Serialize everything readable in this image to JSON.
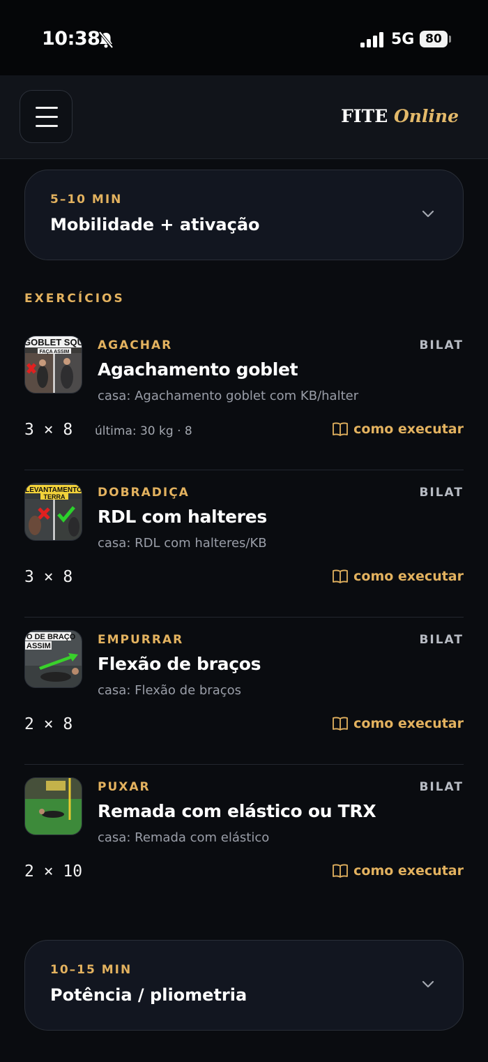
{
  "status": {
    "time": "10:38",
    "network": "5G",
    "battery": "80"
  },
  "header": {
    "brand_main": "FITE",
    "brand_accent": "Online",
    "menu_icon": "hamburger-menu-icon"
  },
  "phases": [
    {
      "time": "5–10 MIN",
      "title": "Mobilidade + ativação"
    },
    {
      "time": "10–15 MIN",
      "title": "Potência / pliometria"
    }
  ],
  "section_label": "EXERCÍCIOS",
  "exercises": [
    {
      "category": "AGACHAR",
      "side": "BILAT",
      "name": "Agachamento goblet",
      "home": "casa: Agachamento goblet com KB/halter",
      "sets": "3 × 8",
      "last": "última: 30 kg · 8",
      "how": "como executar",
      "thumb_text": "GOBLET SQU",
      "thumb_sub": "FAÇA ASSIM"
    },
    {
      "category": "DOBRADIÇA",
      "side": "BILAT",
      "name": "RDL com halteres",
      "home": "casa: RDL com halteres/KB",
      "sets": "3 × 8",
      "last": "",
      "how": "como executar",
      "thumb_text": "LEVANTAMENTO",
      "thumb_sub": "TERRA"
    },
    {
      "category": "EMPURRAR",
      "side": "BILAT",
      "name": "Flexão de braços",
      "home": "casa: Flexão de braços",
      "sets": "2 × 8",
      "last": "",
      "how": "como executar",
      "thumb_text": "O DE BRAÇO",
      "thumb_sub": "ASSIM"
    },
    {
      "category": "PUXAR",
      "side": "BILAT",
      "name": "Remada com elástico ou TRX",
      "home": "casa: Remada com elástico",
      "sets": "2 × 10",
      "last": "",
      "how": "como executar",
      "thumb_text": "",
      "thumb_sub": ""
    }
  ],
  "colors": {
    "accent": "#e3b25f",
    "background": "#0a0c10",
    "card": "#121620"
  }
}
